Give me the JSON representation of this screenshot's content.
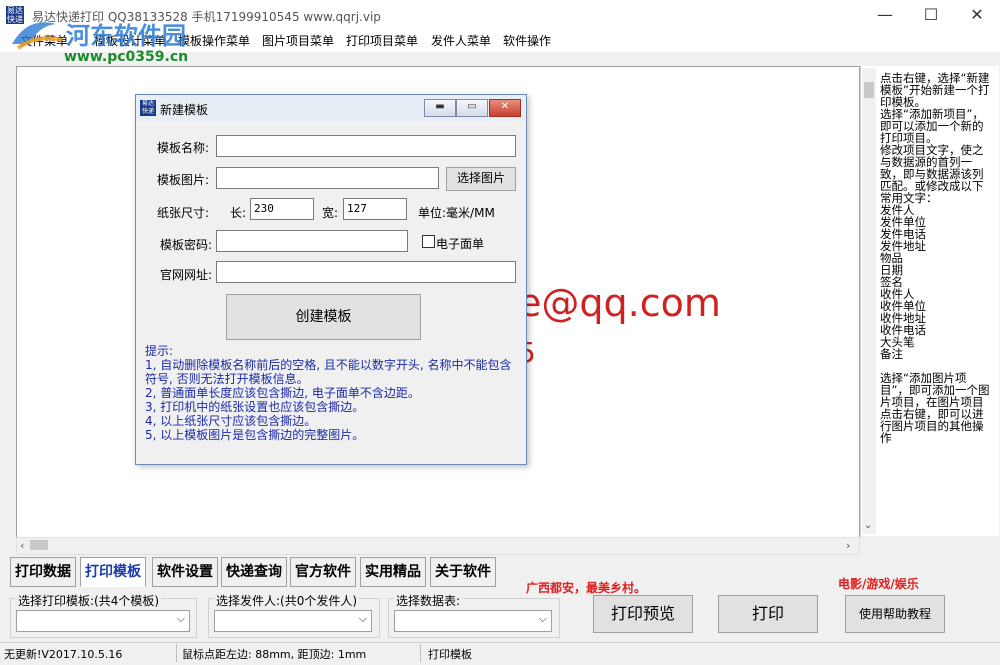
{
  "window": {
    "title": "易达快递打印 QQ38133528 手机17199910545 www.qqrj.vip",
    "app_icon_text": "易达 快递",
    "minimize": "—",
    "maximize": "☐",
    "close": "✕"
  },
  "watermark": {
    "text": "河东软件园",
    "url": "www.pc0359.cn"
  },
  "menu": [
    "文件菜单",
    "模板设计菜单",
    "模板操作菜单",
    "图片项目菜单",
    "打印项目菜单",
    "发件人菜单",
    "软件操作"
  ],
  "canvas": {
    "email_text": "e@qq.com",
    "fragment": "5"
  },
  "help_text": "点击右键，选择“新建模板”开始新建一个打印模板。\n选择“添加新项目”，即可以添加一个新的打印项目。\n修改项目文字，使之与数据源的首列一致，即与数据源该列匹配。或修改成以下常用文字：\n发件人\n发件单位\n发件电话\n发件地址\n物品\n日期\n签名\n收件人\n收件单位\n收件地址\n收件电话\n大头笔\n备注\n\n选择“添加图片项目”，即可添加一个图片项目，在图片项目点击右键，即可以进行图片项目的其他操作",
  "tabs": [
    "打印数据",
    "打印模板",
    "软件设置",
    "快递查询",
    "官方软件",
    "实用精品",
    "关于软件"
  ],
  "active_tab": "打印模板",
  "selectors": {
    "template_label": "选择打印模板:(共4个模板)",
    "sender_label": "选择发件人:(共0个发件人)",
    "datatable_label": "选择数据表:"
  },
  "promo": {
    "left": "广西都安，最美乡村。",
    "right": "电影/游戏/娱乐"
  },
  "buttons": {
    "preview": "打印预览",
    "print": "打印",
    "help": "使用帮助教程"
  },
  "status": {
    "update": "无更新!V2017.10.5.16",
    "mouse": "鼠标点距左边: 88mm, 距顶边: 1mm",
    "mode": "打印模板"
  },
  "dialog": {
    "title": "新建模板",
    "icon_text": "易达 快递",
    "name_label": "模板名称:",
    "name_value": "",
    "image_label": "模板图片:",
    "image_value": "",
    "choose_image": "选择图片",
    "paper_label": "纸张尺寸:",
    "length_label": "长:",
    "length_value": "230",
    "width_label": "宽:",
    "width_value": "127",
    "unit_label": "单位:毫米/MM",
    "password_label": "模板密码:",
    "password_value": "",
    "e_sheet_label": "电子面单",
    "website_label": "官网网址:",
    "website_value": "",
    "create_button": "创建模板",
    "tips": "提示:\n1, 自动删除模板名称前后的空格, 且不能以数字开头, 名称中不能包含符号, 否则无法打开模板信息。\n2, 普通面单长度应该包含撕边, 电子面单不含边距。\n3, 打印机中的纸张设置也应该包含撕边。\n4, 以上纸张尺寸应该包含撕边。\n5, 以上模板图片是包含撕边的完整图片。"
  },
  "colors": {
    "tab_active": "#1a3aa8",
    "promo_red": "#e02020",
    "tips_blue": "#1a2aa8",
    "watermark_blue": "#2a7ad6",
    "watermark_green": "#1a8a2a"
  }
}
